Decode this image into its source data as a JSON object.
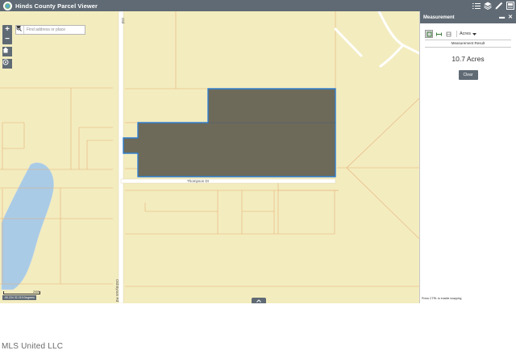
{
  "header": {
    "title": "Hinds County Parcel Viewer",
    "icons": [
      "layer-list-icon",
      "layers-icon",
      "measure-icon",
      "print-icon"
    ]
  },
  "search": {
    "placeholder": "Find address or place"
  },
  "map": {
    "road_labels": {
      "old_byram_rd": "Old Byram Rd",
      "old_top": "Old",
      "thompson_dr": "Thompson Dr"
    },
    "scale_label": "200ft",
    "coordinates": "-90.224 32.219 Degrees",
    "colors": {
      "land": "#f3ecbf",
      "parcel_line": "#e6b077",
      "road": "#ffffff",
      "water": "#a9cbe6",
      "selected_fill": "#6d6a5a",
      "selected_outline": "#2f7fd1"
    }
  },
  "panel": {
    "title": "Measurement",
    "unit": "Acres",
    "result_label": "Measurement Result",
    "result_value": "10.7 Acres",
    "clear_label": "Clear",
    "snap_hint": "Press CTRL to enable snapping"
  },
  "watermark": "MLS United LLC"
}
